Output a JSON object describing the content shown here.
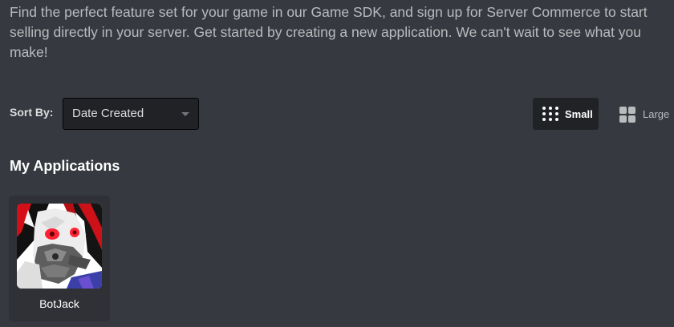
{
  "intro": {
    "text": "Find the perfect feature set for your game in our Game SDK, and sign up for Server Commerce to start selling directly in your server. Get started by creating a new application. We can't wait to see what you make!"
  },
  "sort": {
    "label": "Sort By:",
    "selected": "Date Created",
    "icon": "chevron-down-icon"
  },
  "view_toggle": {
    "selected": "Small",
    "options": [
      {
        "label": "Small",
        "icon": "small-grid-icon"
      },
      {
        "label": "Large",
        "icon": "large-grid-icon"
      }
    ]
  },
  "section": {
    "title": "My Applications"
  },
  "applications": [
    {
      "name": "BotJack",
      "avatar": "app-avatar-image"
    }
  ],
  "colors": {
    "background": "#36393f",
    "card": "#2f3136",
    "input": "#202225",
    "text_muted": "#b9bbbe",
    "text_bright": "#ffffff"
  }
}
